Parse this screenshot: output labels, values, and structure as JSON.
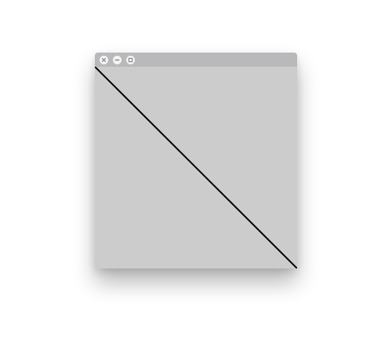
{
  "window": {
    "background_color": "#cccccc",
    "titlebar_color": "#b9b9bc",
    "controls": [
      {
        "name": "close",
        "icon": "close-icon"
      },
      {
        "name": "minimize",
        "icon": "minimize-icon"
      },
      {
        "name": "maximize",
        "icon": "maximize-icon"
      }
    ]
  },
  "drawing": {
    "shape": "diagonal-line",
    "direction": "top-left-to-bottom-right",
    "stroke_color": "#000000"
  }
}
